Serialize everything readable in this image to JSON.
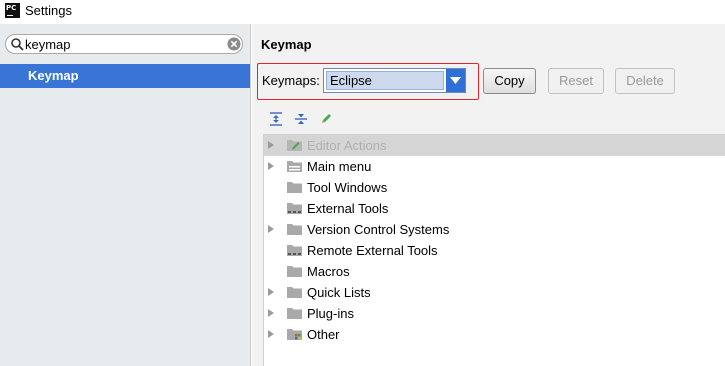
{
  "window": {
    "title": "Settings",
    "app_icon_text": "PC"
  },
  "sidebar": {
    "search": {
      "value": "keymap",
      "placeholder": ""
    },
    "items": [
      {
        "label": "Keymap",
        "selected": true
      }
    ]
  },
  "main": {
    "title": "Keymap",
    "keymaps_label": "Keymaps:",
    "keymap_selected": "Eclipse",
    "buttons": {
      "copy": "Copy",
      "reset": "Reset",
      "delete": "Delete"
    },
    "toolbar_icons": [
      "expand-all-icon",
      "collapse-all-icon",
      "edit-icon"
    ],
    "tree": [
      {
        "label": "Editor Actions",
        "expandable": true,
        "selected": true
      },
      {
        "label": "Main menu",
        "expandable": true,
        "selected": false
      },
      {
        "label": "Tool Windows",
        "expandable": false,
        "selected": false
      },
      {
        "label": "External Tools",
        "expandable": false,
        "selected": false
      },
      {
        "label": "Version Control Systems",
        "expandable": true,
        "selected": false
      },
      {
        "label": "Remote External Tools",
        "expandable": false,
        "selected": false
      },
      {
        "label": "Macros",
        "expandable": false,
        "selected": false
      },
      {
        "label": "Quick Lists",
        "expandable": true,
        "selected": false
      },
      {
        "label": "Plug-ins",
        "expandable": true,
        "selected": false
      },
      {
        "label": "Other",
        "expandable": true,
        "selected": false
      }
    ]
  },
  "colors": {
    "accent": "#3875d7",
    "highlight_border": "#e0262a",
    "dropdown_button": "#2f6fd6"
  }
}
